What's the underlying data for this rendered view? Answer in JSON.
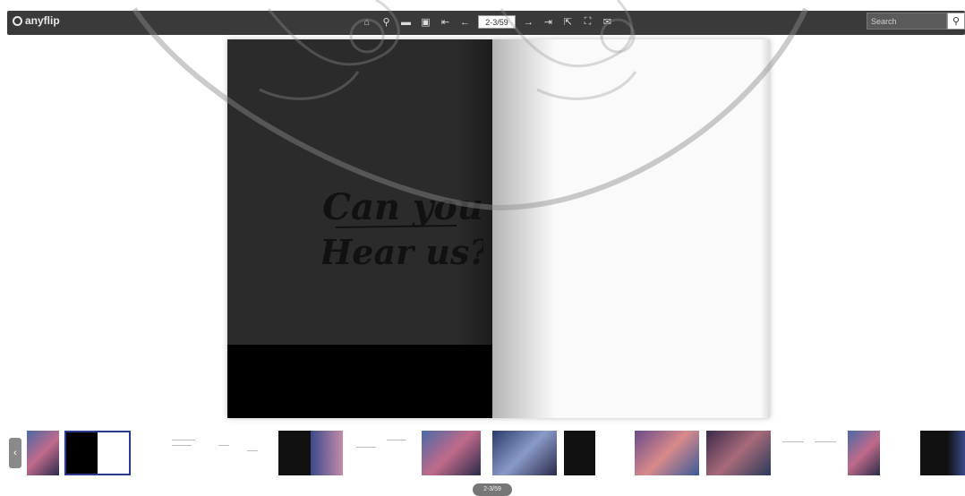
{
  "app": {
    "logo_text": "anyflip"
  },
  "toolbar": {
    "tools": [
      "home-icon",
      "zoom-icon",
      "single-page-icon",
      "thumbnail-icon",
      "first-page-icon",
      "previous-page-icon"
    ],
    "tools_right": [
      "next-page-icon",
      "last-page-icon",
      "share-icon",
      "fullscreen-icon",
      "email-icon"
    ],
    "page_value": "2-3/59"
  },
  "search": {
    "placeholder": "Search"
  },
  "book": {
    "title_line1": "Can you",
    "title_line2": "Hear us?"
  },
  "footer": {
    "page_counter": "2-3/59"
  },
  "colors": {
    "toolbar": "#3a3a3a",
    "left_page": "#2b2b2b",
    "selected_thumb_border": "#2a3b8f"
  }
}
